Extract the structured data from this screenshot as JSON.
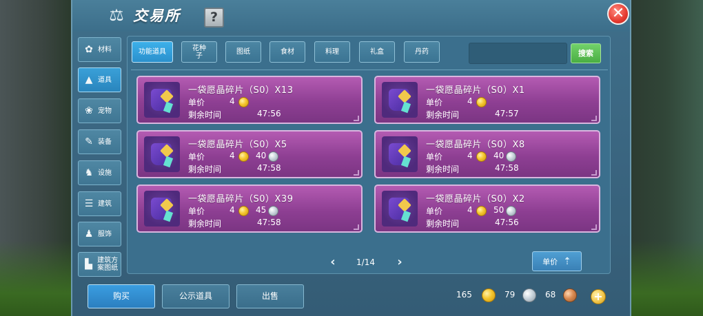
{
  "title": "交易所",
  "help_label": "?",
  "close_label": "✕",
  "sidebar": {
    "items": [
      {
        "label": "材料",
        "icon": "material-icon"
      },
      {
        "label": "道具",
        "icon": "item-icon"
      },
      {
        "label": "宠物",
        "icon": "pet-icon"
      },
      {
        "label": "装备",
        "icon": "equipment-icon"
      },
      {
        "label": "设施",
        "icon": "facility-icon"
      },
      {
        "label": "建筑",
        "icon": "building-icon"
      },
      {
        "label": "服饰",
        "icon": "clothing-icon"
      },
      {
        "label": "建筑方案图纸",
        "icon": "blueprint-icon"
      }
    ],
    "active_index": 1
  },
  "tabs": [
    {
      "label": "功能道具"
    },
    {
      "label": "花种子"
    },
    {
      "label": "图纸"
    },
    {
      "label": "食材"
    },
    {
      "label": "料理"
    },
    {
      "label": "礼盒"
    },
    {
      "label": "丹药"
    }
  ],
  "active_tab_index": 0,
  "search": {
    "value": "",
    "button_label": "搜索"
  },
  "listing_labels": {
    "price": "单价",
    "time_left": "剩余时间"
  },
  "listings": [
    {
      "name": "一袋愿晶碎片（S0）X13",
      "gold": "4",
      "silver": "",
      "time": "47:56"
    },
    {
      "name": "一袋愿晶碎片（S0）X1",
      "gold": "4",
      "silver": "",
      "time": "47:57"
    },
    {
      "name": "一袋愿晶碎片（S0）X5",
      "gold": "4",
      "silver": "40",
      "time": "47:58"
    },
    {
      "name": "一袋愿晶碎片（S0）X8",
      "gold": "4",
      "silver": "40",
      "time": "47:58"
    },
    {
      "name": "一袋愿晶碎片（S0）X39",
      "gold": "4",
      "silver": "45",
      "time": "47:58"
    },
    {
      "name": "一袋愿晶碎片（S0）X2",
      "gold": "4",
      "silver": "50",
      "time": "47:56"
    }
  ],
  "pager": {
    "text": "1/14",
    "prev": "‹",
    "next": "›"
  },
  "sort_button_label": "单价",
  "bottom": {
    "buy_label": "购买",
    "public_label": "公示道具",
    "sell_label": "出售"
  },
  "currency": {
    "gold": "165",
    "silver": "79",
    "bronze": "68",
    "add_label": "+"
  },
  "colors": {
    "accent": "#2b90cc",
    "card": "#9e4aa3",
    "search_button": "#55b84d",
    "close_button": "#e53a30"
  }
}
